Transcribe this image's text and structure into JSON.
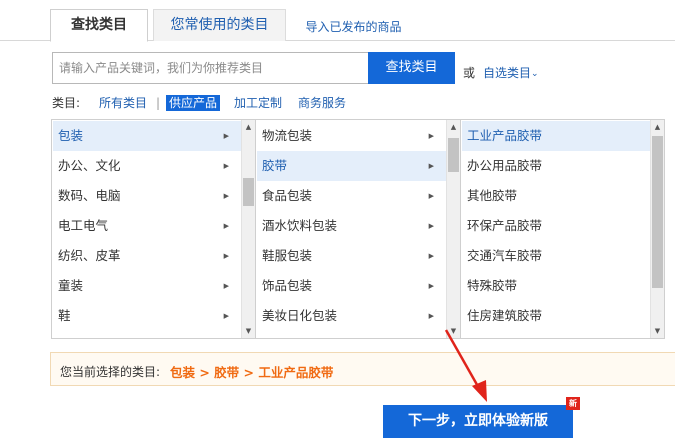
{
  "tabs": {
    "find_category": "查找类目",
    "frequently_used": "您常使用的类目",
    "import_published": "导入已发布的商品"
  },
  "search": {
    "placeholder": "请输入产品关键词，我们为你推荐类目",
    "button_label": "查找类目",
    "or_text": "或",
    "self_select_label": "自选类目"
  },
  "filter": {
    "label": "类目:",
    "options": [
      "所有类目",
      "供应产品",
      "加工定制",
      "商务服务"
    ],
    "selected": "供应产品",
    "separator": "|"
  },
  "columns": [
    {
      "items": [
        "包装",
        "办公、文化",
        "数码、电脑",
        "电工电气",
        "纺织、皮革",
        "童装",
        "鞋"
      ],
      "selected": "包装",
      "scroll_position": 0.35
    },
    {
      "items": [
        "物流包装",
        "胶带",
        "食品包装",
        "酒水饮料包装",
        "鞋服包装",
        "饰品包装",
        "美妆日化包装"
      ],
      "selected": "胶带",
      "scroll_position": 0.1
    },
    {
      "items": [
        "工业产品胶带",
        "办公用品胶带",
        "其他胶带",
        "环保产品胶带",
        "交通汽车胶带",
        "特殊胶带",
        "住房建筑胶带"
      ],
      "selected": "工业产品胶带",
      "scroll_position": 0.0
    }
  ],
  "selection_path": {
    "label": "您当前选择的类目:",
    "value": "包装 > 胶带 > 工业产品胶带"
  },
  "next_button": {
    "label": "下一步，立即体验新版",
    "badge": "新"
  },
  "colors": {
    "accent": "#1468d8",
    "link": "#1f5fb0",
    "path_highlight": "#f06a12",
    "selected_row": "#e4eefa",
    "annotation_arrow": "#e0241b"
  }
}
